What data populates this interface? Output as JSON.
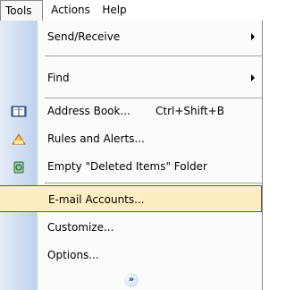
{
  "menubar": {
    "tools": "Tools",
    "actions": "Actions",
    "help": "Help"
  },
  "menu": {
    "items": [
      {
        "label": "Send/Receive",
        "has_submenu": true
      },
      {
        "label": "Find",
        "has_submenu": true
      },
      {
        "label": "Address Book...",
        "shortcut": "Ctrl+Shift+B",
        "icon": "address-book-icon"
      },
      {
        "label": "Rules and Alerts...",
        "icon": "rules-alerts-icon"
      },
      {
        "label": "Empty \"Deleted Items\" Folder",
        "icon": "empty-trash-icon"
      },
      {
        "label": "E-mail Accounts...",
        "highlighted": true
      },
      {
        "label": "Customize..."
      },
      {
        "label": "Options..."
      }
    ],
    "more": "»"
  },
  "colors": {
    "highlight_bg": "#ffeec2",
    "highlight_border": "#3f5a89",
    "gutter_start": "#e4ecf7",
    "gutter_end": "#bfd2ec"
  }
}
